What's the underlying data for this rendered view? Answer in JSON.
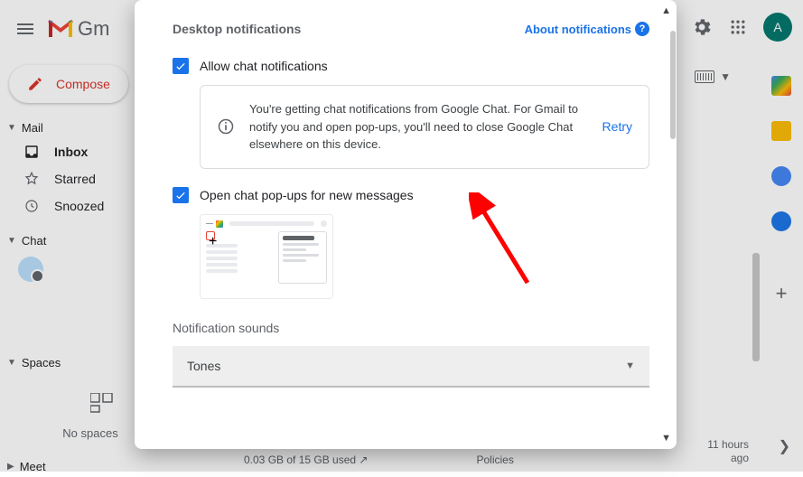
{
  "header": {
    "product": "Gm",
    "avatar_letter": "A"
  },
  "compose_label": "Compose",
  "sections": {
    "mail": "Mail",
    "chat": "Chat",
    "spaces": "Spaces",
    "meet": "Meet"
  },
  "nav": {
    "inbox": "Inbox",
    "starred": "Starred",
    "snoozed": "Snoozed"
  },
  "spaces_empty": "No spaces",
  "footer": {
    "storage": "0.03 GB of 15 GB used",
    "policies": "Policies",
    "hours_l1": "11 hours",
    "hours_l2": "ago"
  },
  "dialog": {
    "title": "Desktop notifications",
    "about": "About notifications",
    "chk_allow": "Allow chat notifications",
    "notice": "You're getting chat notifications from Google Chat. For Gmail to notify you and open pop-ups, you'll need to close Google Chat elsewhere on this device.",
    "retry": "Retry",
    "chk_popups": "Open chat pop-ups for new messages",
    "sounds_hdr": "Notification sounds",
    "sounds_value": "Tones"
  }
}
